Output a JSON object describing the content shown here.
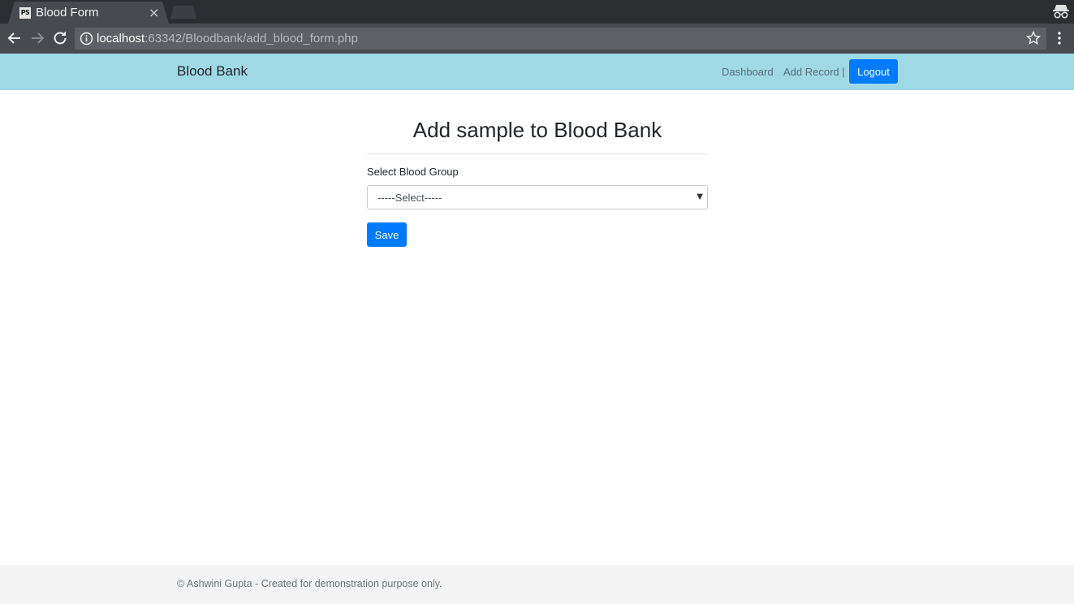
{
  "browser": {
    "tab_title": "Blood Form",
    "favicon_text": "PS",
    "close_glyph": "×",
    "url_host": "localhost",
    "url_rest": ":63342/Bloodbank/add_blood_form.php",
    "icons": [
      "back-icon",
      "forward-icon",
      "reload-icon",
      "info-icon",
      "star-icon",
      "menu-icon",
      "incognito-icon"
    ]
  },
  "navbar": {
    "brand": "Blood Bank",
    "links": [
      "Dashboard",
      "Add Record |"
    ],
    "logout_label": "Logout",
    "background": "#9fd9e6"
  },
  "form": {
    "heading": "Add sample to Blood Bank",
    "group_label": "Select Blood Group",
    "select_value": "-----Select-----",
    "save_label": "Save"
  },
  "footer": {
    "text": "© Ashwini Gupta - Created for demonstration purpose only."
  },
  "colors": {
    "primary": "#007bff",
    "navbar": "#9fd9e6",
    "chrome_dark": "#2b2d30",
    "chrome_toolbar": "#474a4e"
  }
}
